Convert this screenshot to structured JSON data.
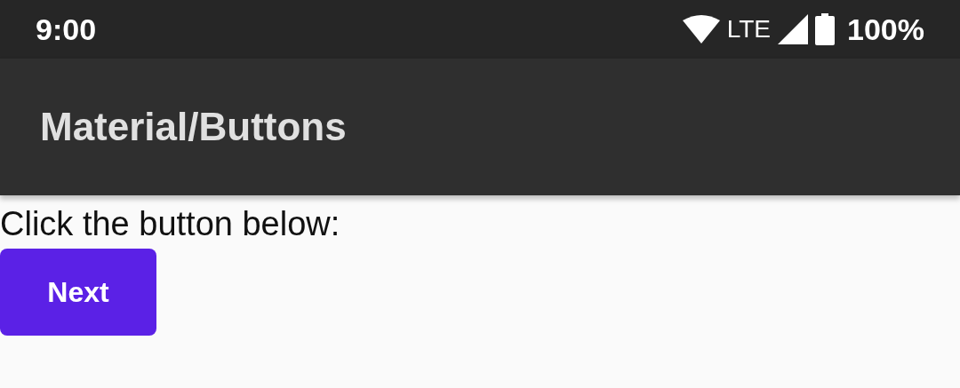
{
  "status_bar": {
    "time": "9:00",
    "network": "LTE",
    "battery": "100%"
  },
  "app_bar": {
    "title": "Material/Buttons"
  },
  "content": {
    "instruction": "Click the button below:",
    "button": {
      "label": "Next"
    }
  }
}
